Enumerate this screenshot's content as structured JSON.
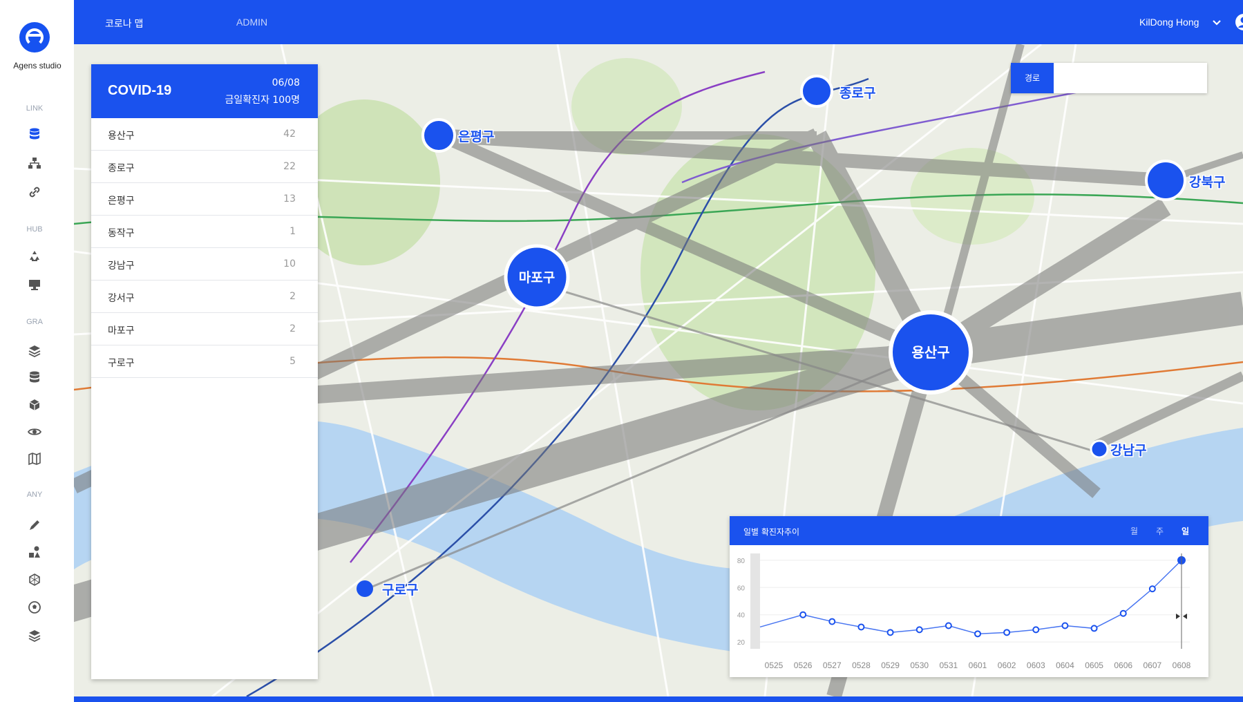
{
  "app": {
    "logo_text": "Agens studio",
    "brand_color": "#1a52ee"
  },
  "rail": {
    "sections": [
      "LINK",
      "HUB",
      "GRA",
      "ANY"
    ],
    "icons": {
      "link": [
        "database-icon",
        "network-icon",
        "link-icon"
      ],
      "hub": [
        "recycle-icon",
        "monitor-icon"
      ],
      "gra": [
        "layers-icon",
        "database-icon",
        "cube-icon",
        "eye-icon",
        "map-icon"
      ],
      "any": [
        "pen-icon",
        "shapes-icon",
        "polygon-icon",
        "soccer-ball-icon",
        "stack-icon"
      ]
    }
  },
  "topbar": {
    "tabs": [
      "코로나 맵",
      "ADMIN"
    ],
    "user_name": "KilDong Hong"
  },
  "panel": {
    "title": "COVID-19",
    "date": "06/08",
    "subtitle": "금일확진자 100명",
    "rows": [
      {
        "name": "용산구",
        "count": "42"
      },
      {
        "name": "종로구",
        "count": "22"
      },
      {
        "name": "은평구",
        "count": "13"
      },
      {
        "name": "동작구",
        "count": "1"
      },
      {
        "name": "강남구",
        "count": "10"
      },
      {
        "name": "강서구",
        "count": "2"
      },
      {
        "name": "마포구",
        "count": "2"
      },
      {
        "name": "구로구",
        "count": "5"
      }
    ]
  },
  "route": {
    "label": "경로"
  },
  "map": {
    "districts": [
      "용산구",
      "마포구",
      "종로구",
      "은평구",
      "강북구",
      "강남구",
      "구로구"
    ]
  },
  "chart_panel": {
    "title": "일별 확진자추이",
    "tabs": [
      "월",
      "주",
      "일"
    ],
    "active_tab": "일"
  },
  "chart_data": {
    "type": "line",
    "categories": [
      "0525",
      "0526",
      "0527",
      "0528",
      "0529",
      "0530",
      "0531",
      "0601",
      "0602",
      "0603",
      "0604",
      "0605",
      "0606",
      "0607",
      "0608"
    ],
    "series": [
      {
        "values": [
          31,
          40,
          35,
          31,
          27,
          29,
          32,
          26,
          27,
          29,
          32,
          30,
          41,
          59,
          80
        ]
      }
    ],
    "y_ticks": [
      20,
      40,
      60,
      80
    ],
    "ylim": [
      15,
      85
    ],
    "grid": true,
    "line_color": "#1a52ee"
  }
}
